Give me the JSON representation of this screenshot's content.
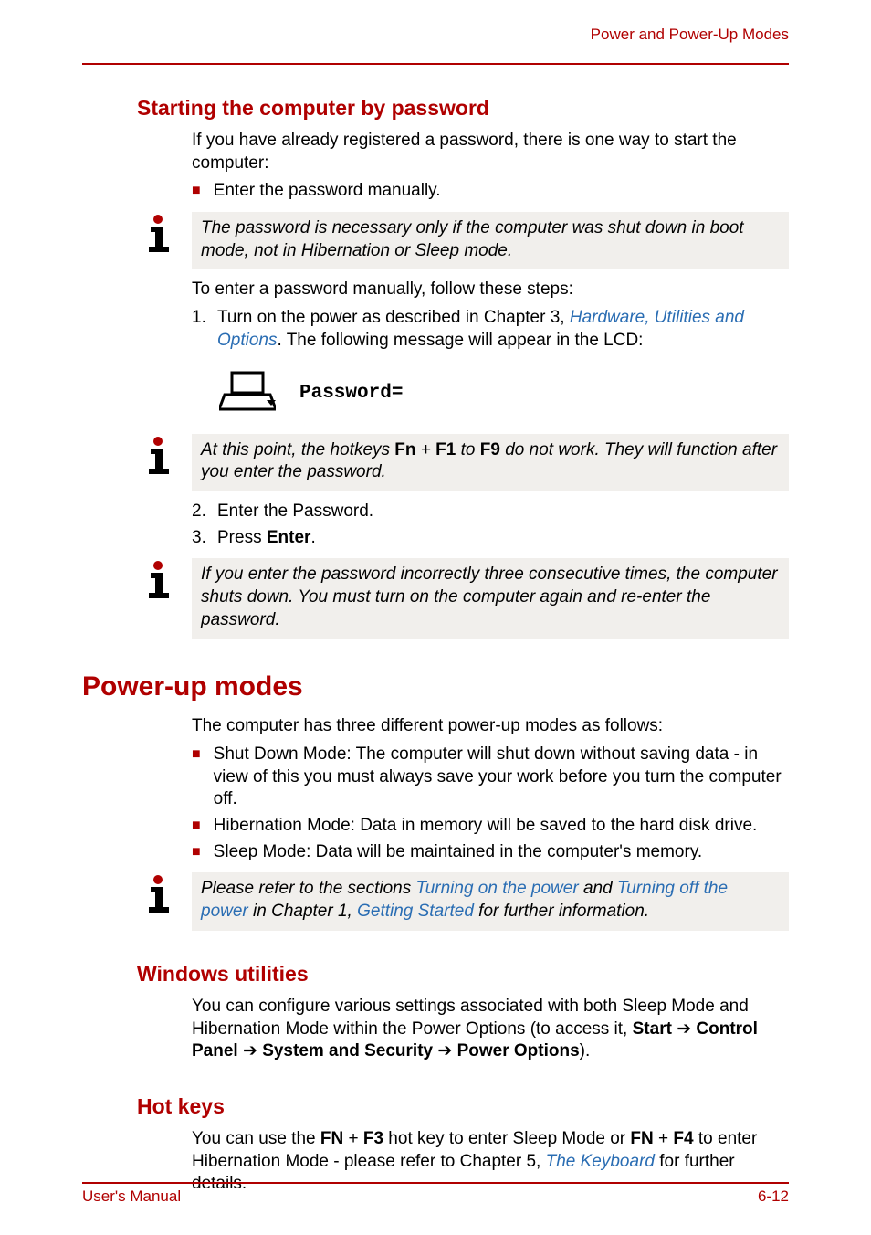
{
  "header": {
    "label": "Power and Power-Up Modes"
  },
  "section1": {
    "heading": "Starting the computer by password",
    "intro": "If you have already registered a password, there is one way to start the computer:",
    "bullet1": "Enter the password manually.",
    "note1": "The password is necessary only if the computer was shut down in boot mode, not in Hibernation or Sleep mode.",
    "para2": "To enter a password manually, follow these steps:",
    "step1_pre": "Turn on the power as described in Chapter 3, ",
    "step1_link": "Hardware, Utilities and Options",
    "step1_post": ". The following message will appear in the LCD:",
    "prompt": "Password=",
    "note2_pre": "At this point, the hotkeys ",
    "note2_fn": "Fn",
    "note2_plus": " + ",
    "note2_f1": "F1",
    "note2_mid": " to ",
    "note2_f9": "F9",
    "note2_post": " do not work. They will function after you enter the password.",
    "step2": "Enter the Password.",
    "step3_pre": "Press ",
    "step3_enter": "Enter",
    "step3_post": ".",
    "note3": "If you enter the password incorrectly three consecutive times, the computer shuts down. You must turn on the computer again and re-enter the password."
  },
  "section2": {
    "heading": "Power-up modes",
    "intro": "The computer has three different power-up modes as follows:",
    "b1": "Shut Down Mode: The computer will shut down without saving data - in view of this you must always save your work before you turn the computer off.",
    "b2": "Hibernation Mode: Data in memory will be saved to the hard disk drive.",
    "b3": "Sleep Mode: Data will be maintained in the computer's memory.",
    "note_pre": "Please refer to the sections ",
    "note_l1": "Turning on the power",
    "note_mid1": " and ",
    "note_l2": "Turning off the power",
    "note_mid2": " in Chapter 1, ",
    "note_l3": "Getting Started",
    "note_post": " for further information."
  },
  "section3": {
    "heading": "Windows utilities",
    "p_pre": "You can configure various settings associated with both Sleep Mode and Hibernation Mode within the Power Options (to access it, ",
    "start": "Start",
    "arrow": " ➔ ",
    "cp": "Control Panel",
    "ss": "System and Security",
    "po": "Power Options",
    "p_post": ")."
  },
  "section4": {
    "heading": "Hot keys",
    "p_pre": "You can use the ",
    "fn": "FN",
    "plus": " + ",
    "f3": "F3",
    "mid1": " hot key to enter Sleep Mode or ",
    "f4": "F4",
    "mid2": " to enter Hibernation Mode - please refer to Chapter 5, ",
    "link": "The Keyboard",
    "post": " for further details."
  },
  "footer": {
    "left": "User's Manual",
    "right": "6-12"
  }
}
